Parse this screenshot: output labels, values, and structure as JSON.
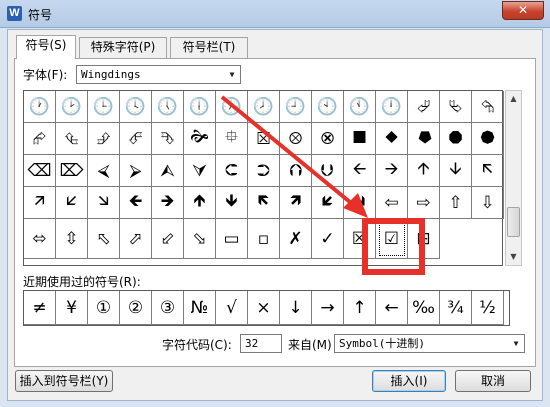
{
  "window": {
    "title": "符号",
    "app_icon": "W",
    "close_glyph": "✕"
  },
  "tabs": [
    {
      "label": "符号(S)",
      "active": true
    },
    {
      "label": "特殊字符(P)",
      "active": false
    },
    {
      "label": "符号栏(T)",
      "active": false
    }
  ],
  "font_label": "字体(F):",
  "font_value": "Wingdings",
  "symbol_rows": [
    [
      "🕐",
      "🕑",
      "🕒",
      "🕓",
      "🕔",
      "🕕",
      "🕖",
      "🕗",
      "🕘",
      "🕙",
      "🕚",
      "🕛",
      "⮰",
      "⮱",
      "⮲"
    ],
    [
      "⮳",
      "⮴",
      "⮵",
      "⮶",
      "⮷",
      "🙞",
      "⯐",
      "⮽",
      "⮾",
      "⮿",
      "⯀",
      "⯁",
      "⯂",
      "⯃",
      "⯄"
    ],
    [
      "⌫",
      "⌦",
      "⮘",
      "⮚",
      "⮙",
      "⮛",
      "⮈",
      "⮊",
      "⮉",
      "⮋",
      "🡨",
      "🡪",
      "🡩",
      "🡫",
      "🡬"
    ],
    [
      "🡭",
      "🡯",
      "🡮",
      "🡸",
      "🡺",
      "🡹",
      "🡻",
      "🡼",
      "🡽",
      "🡿",
      "🡾",
      "⇦",
      "⇨",
      "⇧",
      "⇩"
    ],
    [
      "⬄",
      "⇳",
      "⬁",
      "⬀",
      "⬃",
      "⬂",
      "▭",
      "▫",
      "✗",
      "✓",
      "☒",
      "☑",
      "⊞",
      "",
      ""
    ]
  ],
  "recent_label": "近期使用过的符号(R):",
  "recent_symbols": [
    "≠",
    "¥",
    "①",
    "②",
    "③",
    "№",
    "√",
    "×",
    "↓",
    "→",
    "↑",
    "←",
    "‰",
    "¾",
    "½"
  ],
  "char_code_label": "字符代码(C):",
  "char_code_value": "32",
  "from_label": "来自(M)",
  "from_value": "Symbol(十进制)",
  "buttons": {
    "insert_to_bar": "插入到符号栏(Y)",
    "insert": "插入(I)",
    "cancel": "取消"
  },
  "annotation_color": "#e8302b"
}
